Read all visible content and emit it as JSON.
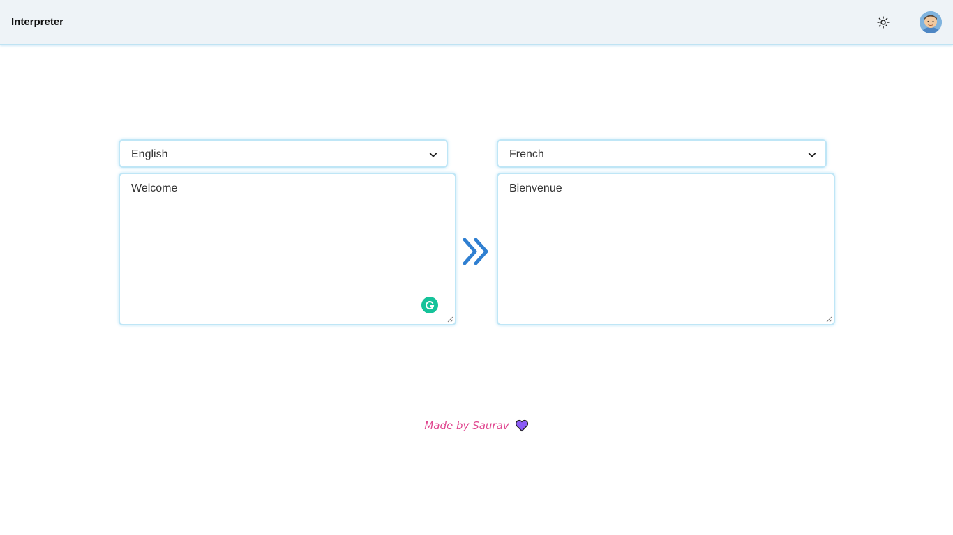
{
  "header": {
    "title": "Interpreter",
    "theme_icon": "sun-icon",
    "avatar_icon": "user-avatar"
  },
  "source": {
    "language": "English",
    "text": "Welcome"
  },
  "target": {
    "language": "French",
    "text": "Bienvenue"
  },
  "swap_icon": "double-chevron-right-icon",
  "footer": {
    "credit": "Made by Saurav",
    "heart_icon": "heart-icon"
  },
  "colors": {
    "accent": "#2f7fd1",
    "credit": "#e0468f",
    "heart": "#8b5cf6",
    "grammarly": "#15c39a",
    "border": "#bfe6f6"
  }
}
